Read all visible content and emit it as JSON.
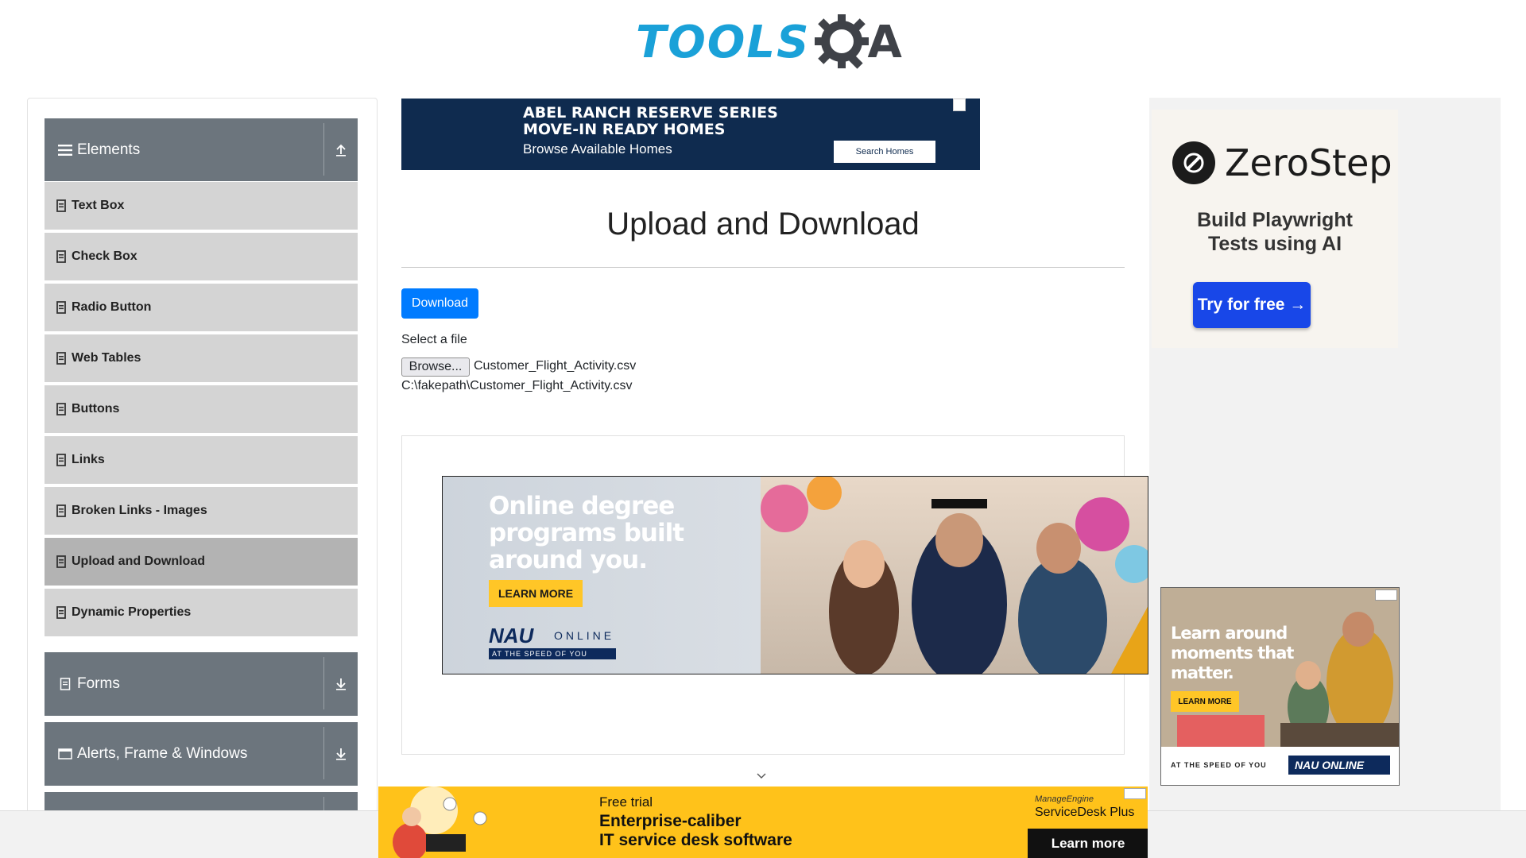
{
  "header": {
    "logo_text_tools": "TOOLS",
    "logo_text_a": "A"
  },
  "sidebar": {
    "groups": [
      {
        "label": "Elements",
        "icon": "hamburger-icon",
        "expanded": true
      },
      {
        "label": "Forms",
        "icon": "form-icon",
        "expanded": false
      },
      {
        "label": "Alerts, Frame & Windows",
        "icon": "window-icon",
        "expanded": false
      }
    ],
    "items": [
      {
        "label": "Text Box"
      },
      {
        "label": "Check Box"
      },
      {
        "label": "Radio Button"
      },
      {
        "label": "Web Tables"
      },
      {
        "label": "Buttons"
      },
      {
        "label": "Links"
      },
      {
        "label": "Broken Links - Images"
      },
      {
        "label": "Upload and Download",
        "active": true
      },
      {
        "label": "Dynamic Properties"
      }
    ]
  },
  "top_ad": {
    "line1": "ABEL RANCH RESERVE SERIES",
    "line2": "MOVE-IN READY HOMES",
    "line3": "Browse Available Homes",
    "button": "Search Homes"
  },
  "main": {
    "title": "Upload and Download",
    "download_button": "Download",
    "select_label": "Select a file",
    "browse_button": "Browse...",
    "file_name": "Customer_Flight_Activity.csv",
    "file_path": "C:\\fakepath\\Customer_Flight_Activity.csv"
  },
  "nau_ad": {
    "headline_1": "Online degree",
    "headline_2": "programs built",
    "headline_3": "around you.",
    "button": "LEARN MORE",
    "logo": "NAU",
    "online": "ONLINE",
    "tagline": "AT THE SPEED OF YOU"
  },
  "zerostep_ad": {
    "name": "ZeroStep",
    "sub_1": "Build Playwright",
    "sub_2": "Tests using AI",
    "button": "Try for free →"
  },
  "nau_ad_2": {
    "headline_1": "Learn around",
    "headline_2": "moments that",
    "headline_3": "matter.",
    "button": "LEARN MORE",
    "tagline": "AT THE SPEED OF YOU",
    "logo": "NAU ONLINE"
  },
  "bottom_ad": {
    "line1": "Free trial",
    "line2": "Enterprise-caliber",
    "line3": "IT service desk software",
    "brand_top": "ManageEngine",
    "brand": "ServiceDesk Plus",
    "button": "Learn more"
  },
  "colors": {
    "accent_blue": "#007bff",
    "sidebar_header": "#6c757d",
    "sidebar_item": "#d4d4d4",
    "sidebar_item_active": "#b3b3b3",
    "logo_blue": "#1aa1d8"
  }
}
